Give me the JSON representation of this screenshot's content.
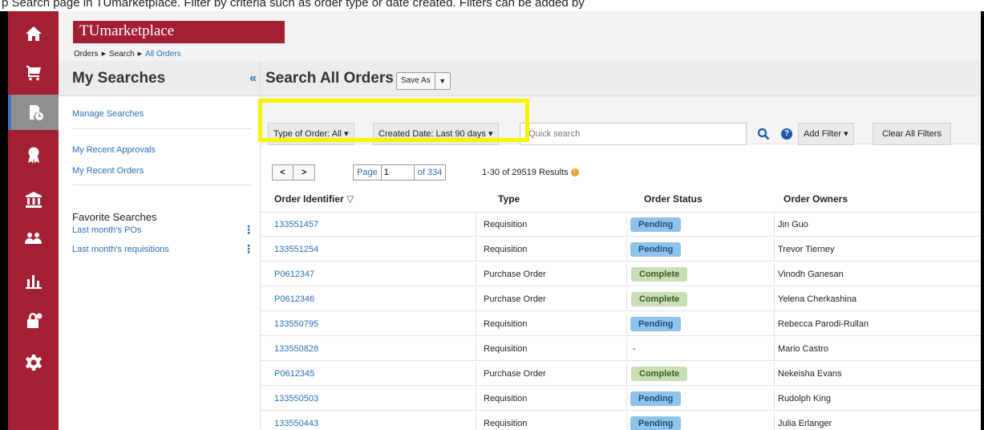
{
  "caption": "p Search page in TUmarketplace. Filter by criteria such as order type or date created. Filters can be added by",
  "brand": "TUmarketplace",
  "breadcrumb": {
    "items": [
      "Orders",
      "Search"
    ],
    "current": "All Orders"
  },
  "rail_icons": [
    "home-icon",
    "cart-icon",
    "documents-clock-icon",
    "award-icon",
    "bank-icon",
    "users-icon",
    "bar-chart-icon",
    "lock-gear-icon",
    "gear-icon"
  ],
  "left_panel": {
    "title": "My Searches",
    "collapse_glyph": "«",
    "manage_searches": "Manage Searches",
    "recent_approvals": "My Recent Approvals",
    "recent_orders": "My Recent Orders",
    "favorites_title": "Favorite Searches",
    "favorites": [
      "Last month's POs",
      "Last month's requisitions"
    ]
  },
  "main": {
    "title": "Search All Orders",
    "save_as": "Save As",
    "filters": {
      "type_of_order": "Type of Order: All ▾",
      "created_date": "Created Date: Last 90 days ▾",
      "search_placeholder": "Quick search",
      "add_filter": "Add Filter ▾",
      "clear_all": "Clear All Filters"
    },
    "pagination": {
      "prev": "<",
      "next": ">",
      "page_label": "Page",
      "page_value": "1",
      "of_pages": "of 334"
    },
    "results_text": "1-30 of 29519 Results",
    "table": {
      "headers": [
        "Order Identifier",
        "Type",
        "Order Status",
        "Order Owners"
      ],
      "sort_glyph": "▽",
      "rows": [
        {
          "id": "133551457",
          "type": "Requisition",
          "status": "Pending",
          "owner": "Jin Guo"
        },
        {
          "id": "133551254",
          "type": "Requisition",
          "status": "Pending",
          "owner": "Trevor Tierney"
        },
        {
          "id": "P0612347",
          "type": "Purchase Order",
          "status": "Complete",
          "owner": "Vinodh Ganesan"
        },
        {
          "id": "P0612346",
          "type": "Purchase Order",
          "status": "Complete",
          "owner": "Yelena Cherkashina"
        },
        {
          "id": "133550795",
          "type": "Requisition",
          "status": "Pending",
          "owner": "Rebecca Parodi-Rullan"
        },
        {
          "id": "133550828",
          "type": "Requisition",
          "status": "-",
          "owner": "Mario Castro"
        },
        {
          "id": "P0612345",
          "type": "Purchase Order",
          "status": "Complete",
          "owner": "Nekeisha Evans"
        },
        {
          "id": "133550503",
          "type": "Requisition",
          "status": "Pending",
          "owner": "Rudolph King"
        },
        {
          "id": "133550443",
          "type": "Requisition",
          "status": "Pending",
          "owner": "Julia Erlanger"
        }
      ]
    }
  },
  "colors": {
    "brand": "#a31f34",
    "link": "#2a6fb8",
    "highlight": "#f5f500",
    "pending": "#8fc4ea",
    "complete": "#c9e0b6"
  }
}
